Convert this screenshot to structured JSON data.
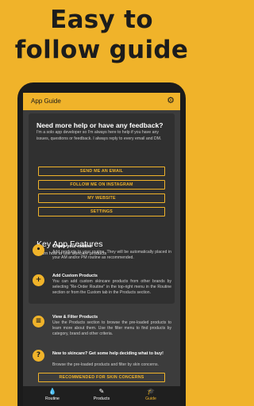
{
  "headline": {
    "line1": "Easy to",
    "line2": "follow guide"
  },
  "appbar": {
    "title": "App Guide",
    "settings_icon": "gear-icon"
  },
  "feedback": {
    "title": "Need more help or have any feedback?",
    "body": "I'm a solo app developer so I'm always here to help if you have any issues, questions or feedback. I always reply to every email and DM.",
    "buttons": [
      "SEND ME AN EMAIL",
      "FOLLOW ME ON INSTAGRAM",
      "MY WEBSITE",
      "SETTINGS"
    ]
  },
  "features": {
    "title": "Key App Features",
    "subtitle": "Learn how to use skincare products",
    "items": [
      {
        "icon": "info-icon",
        "glyph": "•",
        "title": "Create your routine",
        "desc": "Add products to your routine. They will be automatically placed in your AM and/or PM routine as recommended."
      },
      {
        "icon": "plus-icon",
        "glyph": "+",
        "title": "Add Custom Products",
        "desc": "You can add custom skincare products from other brands by selecting \"Re-Order Routine\" in the top-right menu in the Routine section or from the Custom tab in the Products section."
      },
      {
        "icon": "list-icon",
        "glyph": "≡",
        "title": "View & Filter Products",
        "desc": "Use the Products section to browse the pre-loaded products to learn more about them. Use the filter menu to find products by category, brand and other criteria."
      },
      {
        "icon": "question-icon",
        "glyph": "?",
        "title": "New to skincare? Get some help deciding what to buy!",
        "desc": "Browse the pre-loaded products and filter by skin concerns."
      }
    ],
    "cta": "RECOMMENDED FOR SKIN CONCERNS"
  },
  "nav": [
    {
      "icon": "drop-icon",
      "glyph": "💧",
      "label": "Routine",
      "active": false
    },
    {
      "icon": "pencil-icon",
      "glyph": "✎",
      "label": "Products",
      "active": false
    },
    {
      "icon": "graduation-cap-icon",
      "glyph": "🎓",
      "label": "Guide",
      "active": true
    }
  ],
  "colors": {
    "accent": "#f0b32a",
    "screen_bg": "#3c3c3c",
    "card_bg": "#303030"
  }
}
